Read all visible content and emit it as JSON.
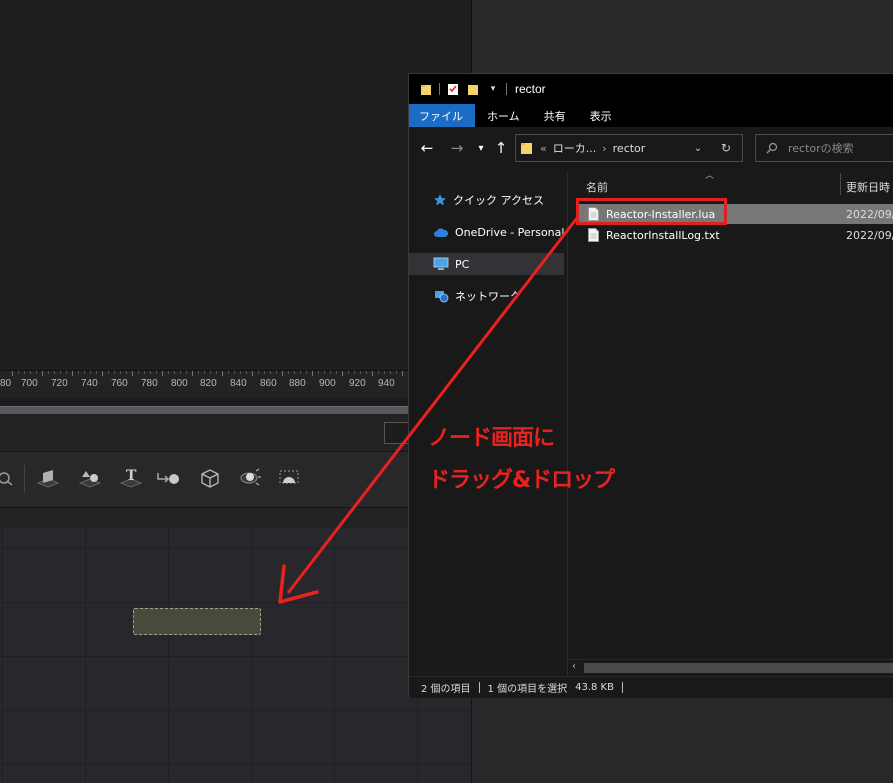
{
  "ruler": {
    "ticks": [
      "80",
      "700",
      "720",
      "740",
      "760",
      "780",
      "800",
      "820",
      "840",
      "860",
      "880",
      "900",
      "920",
      "940"
    ]
  },
  "toolbar": {
    "icons": [
      "effect-icon",
      "image-plane-icon",
      "shape3d-icon",
      "text3d-icon",
      "merge3d-icon",
      "camera3d-icon",
      "light-icon",
      "renderer3d-icon"
    ]
  },
  "explorer": {
    "title": "rector",
    "ribbon": {
      "tabs": [
        "ファイル",
        "ホーム",
        "共有",
        "表示"
      ]
    },
    "address": {
      "prefix": "«",
      "segments": [
        "ローカ...",
        "rector"
      ]
    },
    "search": {
      "placeholder": "rectorの検索"
    },
    "nav": {
      "items": [
        {
          "label": "クイック アクセス",
          "icon": "star-icon"
        },
        {
          "label": "OneDrive - Personal",
          "icon": "cloud-icon"
        },
        {
          "label": "PC",
          "icon": "computer-icon",
          "selected": true
        },
        {
          "label": "ネットワーク",
          "icon": "network-icon"
        }
      ]
    },
    "columns": {
      "name": "名前",
      "date": "更新日時"
    },
    "files": [
      {
        "name": "Reactor-Installer.lua",
        "date": "2022/09/",
        "selected": true
      },
      {
        "name": "ReactorInstallLog.txt",
        "date": "2022/09/",
        "selected": false
      }
    ],
    "status": {
      "count": "2 個の項目",
      "selection": "1 個の項目を選択",
      "size": "43.8 KB"
    }
  },
  "annotation": {
    "line1": "ノード画面に",
    "line2": "ドラッグ&ドロップ",
    "color": "#e8221f"
  }
}
